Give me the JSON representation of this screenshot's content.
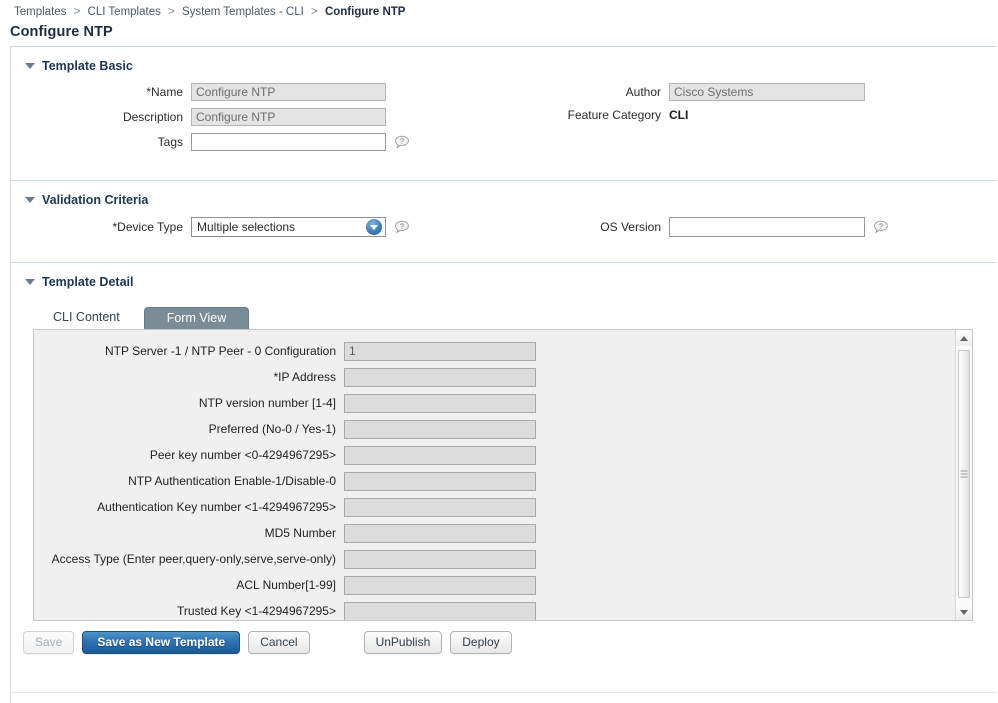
{
  "breadcrumb": {
    "items": [
      {
        "label": "Templates",
        "current": false
      },
      {
        "label": "CLI Templates",
        "current": false
      },
      {
        "label": "System Templates - CLI",
        "current": false
      },
      {
        "label": "Configure NTP",
        "current": true
      }
    ],
    "separator": ">"
  },
  "page_title": "Configure NTP",
  "sections": {
    "template_basic": {
      "title": "Template Basic",
      "fields": {
        "name_label": "*Name",
        "name_value": "Configure NTP",
        "description_label": "Description",
        "description_value": "Configure NTP",
        "tags_label": "Tags",
        "tags_value": "",
        "author_label": "Author",
        "author_value": "Cisco Systems",
        "feature_category_label": "Feature Category",
        "feature_category_value": "CLI"
      }
    },
    "validation_criteria": {
      "title": "Validation Criteria",
      "fields": {
        "device_type_label": "*Device Type",
        "device_type_value": "Multiple selections",
        "os_version_label": "OS Version",
        "os_version_value": ""
      }
    },
    "template_detail": {
      "title": "Template Detail",
      "tabs": [
        {
          "label": "CLI Content",
          "active": false
        },
        {
          "label": "Form View",
          "active": true
        }
      ],
      "form_rows": [
        {
          "label": "NTP Server -1 / NTP Peer - 0 Configuration",
          "value": "1"
        },
        {
          "label": "*IP Address",
          "value": ""
        },
        {
          "label": "NTP version number [1-4]",
          "value": ""
        },
        {
          "label": "Preferred (No-0 / Yes-1)",
          "value": ""
        },
        {
          "label": "Peer key number <0-4294967295>",
          "value": ""
        },
        {
          "label": "NTP Authentication Enable-1/Disable-0",
          "value": ""
        },
        {
          "label": "Authentication Key number <1-4294967295>",
          "value": ""
        },
        {
          "label": "MD5 Number",
          "value": ""
        },
        {
          "label": "Access Type (Enter peer,query-only,serve,serve-only)",
          "value": ""
        },
        {
          "label": "ACL Number[1-99]",
          "value": ""
        },
        {
          "label": "Trusted Key <1-4294967295>",
          "value": ""
        }
      ]
    }
  },
  "buttons": {
    "save": "Save",
    "save_as_new_template": "Save as New Template",
    "cancel": "Cancel",
    "unpublish": "UnPublish",
    "deploy": "Deploy"
  },
  "icons": {
    "help": "help-bubble-icon",
    "dropdown": "chevron-down-icon",
    "collapse": "triangle-down-icon",
    "scroll_up": "scroll-up-arrow-icon",
    "scroll_down": "scroll-down-arrow-icon"
  },
  "colors": {
    "primary_button": "#2e72b0",
    "section_title": "#1d3557",
    "active_tab": "#7b8c99"
  }
}
